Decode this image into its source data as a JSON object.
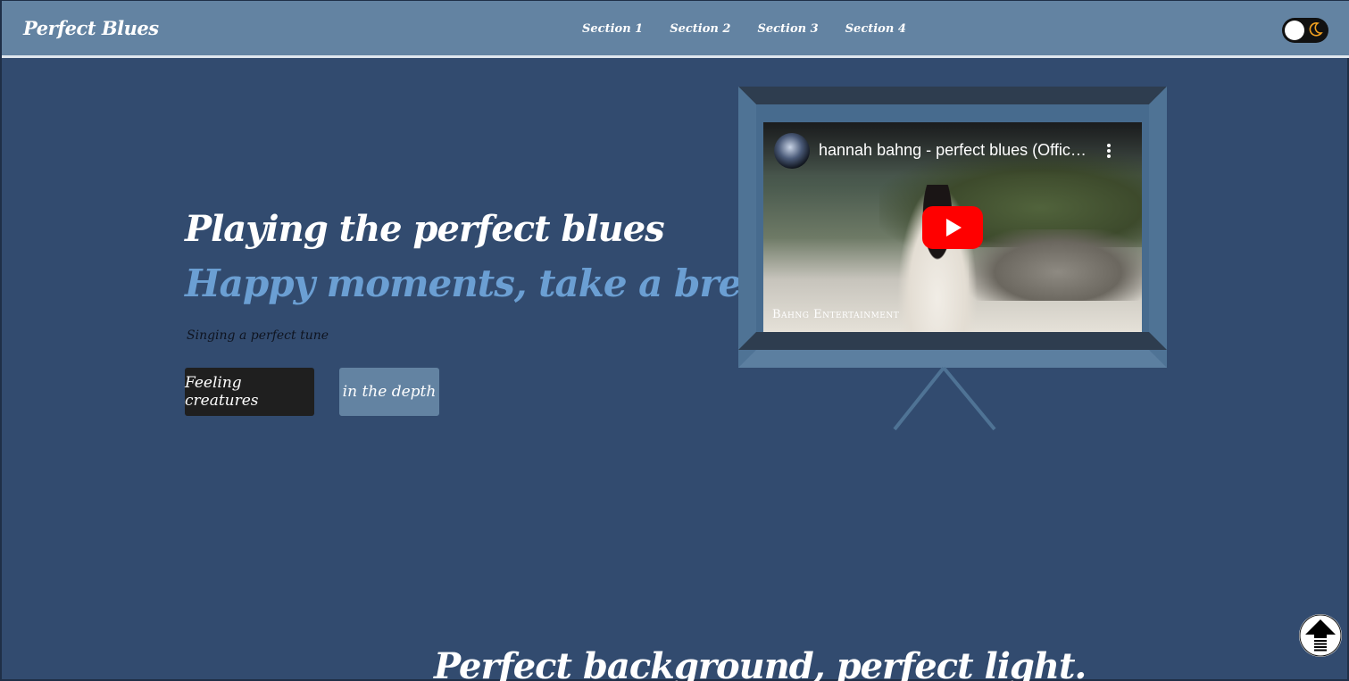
{
  "header": {
    "brand": "Perfect Blues",
    "nav": [
      "Section 1",
      "Section 2",
      "Section 3",
      "Section 4"
    ],
    "theme_toggle_icon": "moon-icon"
  },
  "hero": {
    "headline": "Playing the perfect blues",
    "subheadline": "Happy moments, take a breath",
    "tagline": "Singing a perfect tune",
    "buttons": {
      "primary": "Feeling creatures",
      "secondary": "in the depth"
    }
  },
  "video": {
    "title": "hannah bahng - perfect blues (Official Video)",
    "watermark": "Bahng Entertainment",
    "play_icon": "play-icon",
    "menu_icon": "more-vertical-icon"
  },
  "section2": {
    "title": "Perfect background, perfect light."
  },
  "scroll_top_icon": "arrow-up-icon",
  "colors": {
    "page_bg": "#324b6f",
    "header_bg": "#6383a2",
    "accent_blue": "#6b9fd3",
    "button_dark": "#1f1f1f",
    "youtube_red": "#ff0000"
  }
}
